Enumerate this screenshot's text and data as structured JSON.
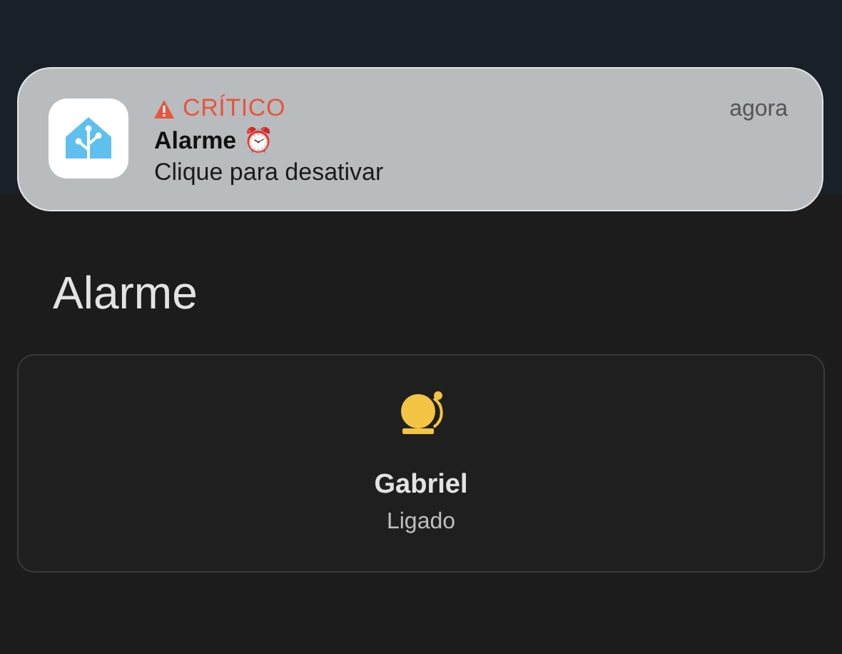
{
  "notification": {
    "severity": "CRÍTICO",
    "title": "Alarme ⏰",
    "body": "Clique para desativar",
    "time": "agora"
  },
  "page": {
    "title": "Alarme"
  },
  "card": {
    "name": "Gabriel",
    "state": "Ligado",
    "on": true
  }
}
